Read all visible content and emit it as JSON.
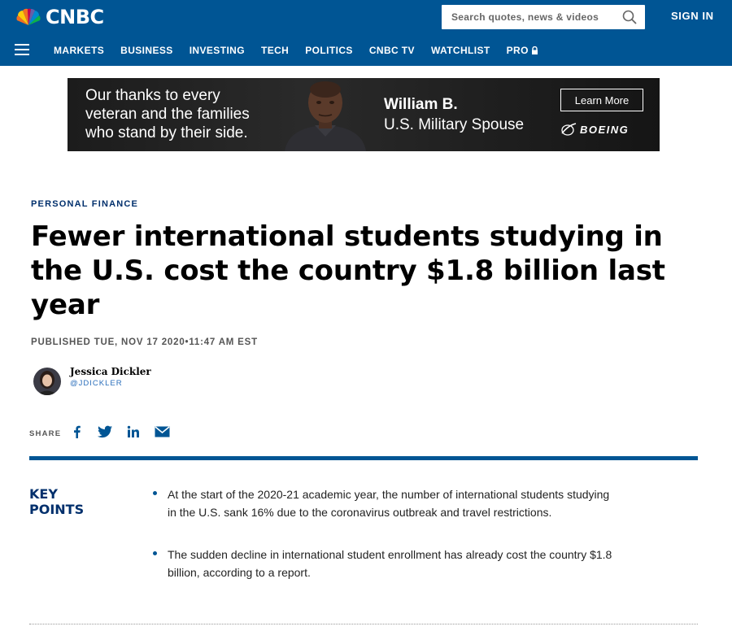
{
  "header": {
    "logo_text": "CNBC",
    "search_placeholder": "Search quotes, news & videos",
    "signin_label": "SIGN IN",
    "nav": [
      "MARKETS",
      "BUSINESS",
      "INVESTING",
      "TECH",
      "POLITICS",
      "CNBC TV",
      "WATCHLIST",
      "PRO"
    ],
    "accent_color": "#005594"
  },
  "ad": {
    "message": "Our thanks to every veteran and the families who stand by their side.",
    "name": "William B.",
    "role": "U.S. Military Spouse",
    "button_label": "Learn More",
    "brand": "BOEING"
  },
  "article": {
    "section": "PERSONAL FINANCE",
    "headline": "Fewer international students studying in the U.S. cost the country $1.8 billion last year",
    "published": "PUBLISHED TUE, NOV 17 2020•11:47 AM EST",
    "author": "Jessica Dickler",
    "handle": "@JDICKLER",
    "share_label": "SHARE",
    "share_icons": [
      "facebook-icon",
      "twitter-icon",
      "linkedin-icon",
      "email-icon"
    ]
  },
  "key_points": {
    "title": "KEY POINTS",
    "items": [
      "At the start of the 2020-21 academic year, the number of international students studying in the U.S. sank 16% due to the coronavirus outbreak and travel restrictions.",
      "The sudden decline in international student enrollment has already cost the country $1.8 billion, according to a report."
    ]
  }
}
